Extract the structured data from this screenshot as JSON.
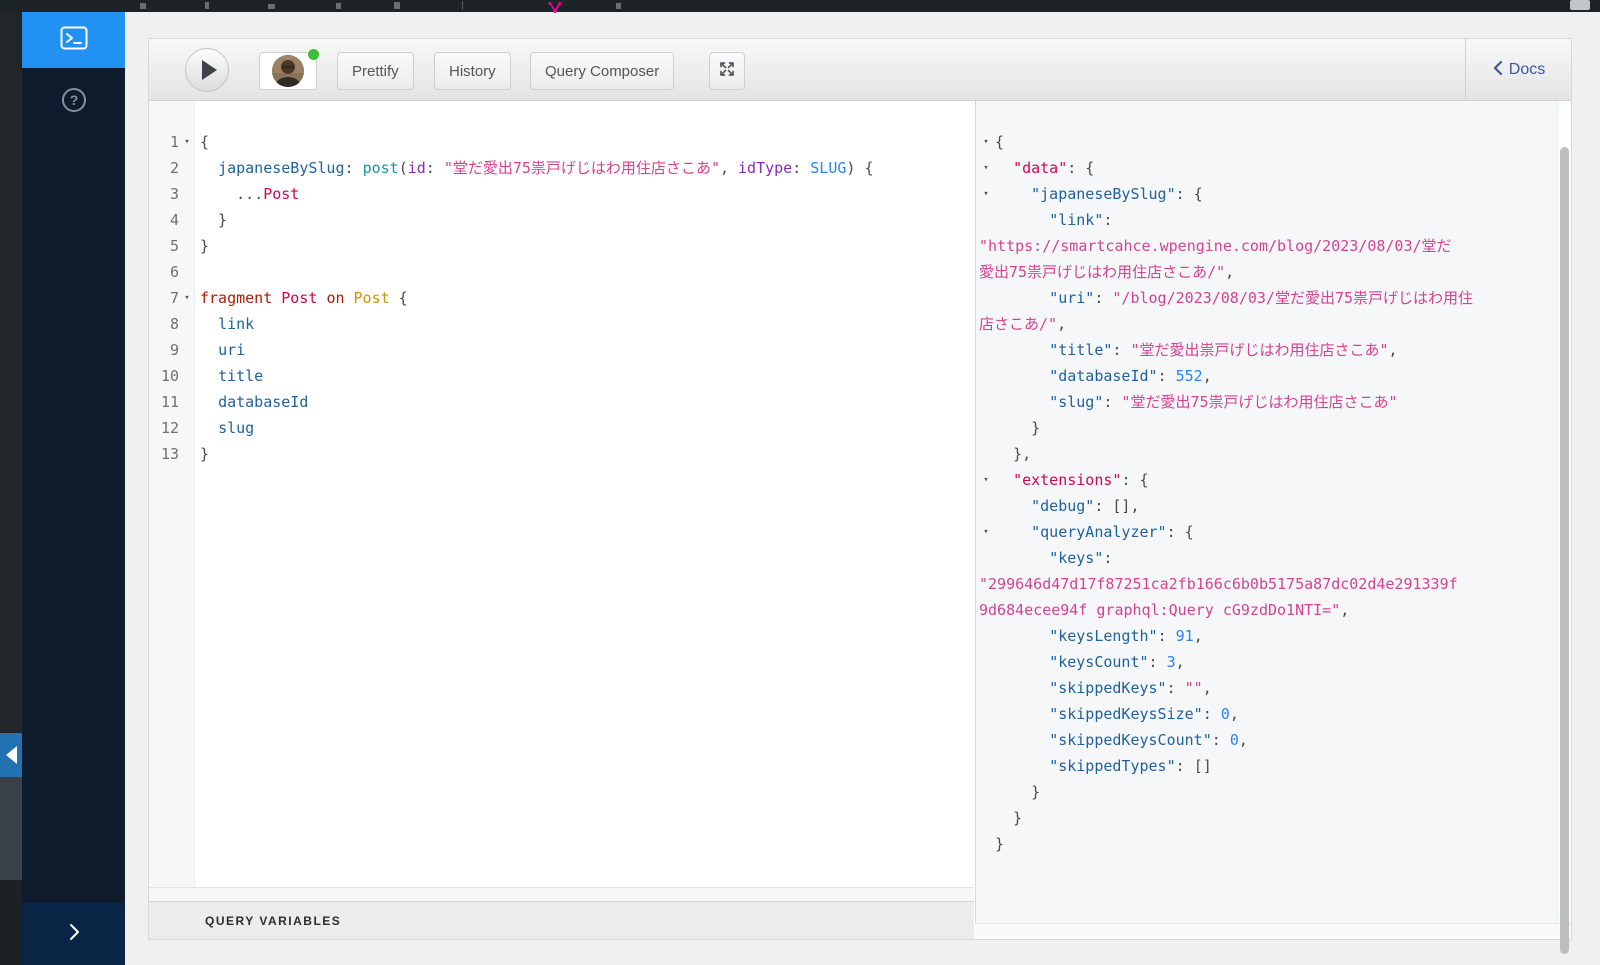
{
  "colors": {
    "admin_bar_bg": "#1d2327",
    "sidebar_bg": "#0d1b2c",
    "sidebar_active": "#2191f3",
    "graphql_magenta": "#e10098",
    "status_green": "#3cc13b",
    "docs_blue": "#3b5998",
    "tok_property": "#1F61A0",
    "tok_alias_field": "#1C92A9",
    "tok_argument": "#8B2BB9",
    "tok_string": "#D64292",
    "tok_number": "#2882F9",
    "tok_keyword": "#B11A04",
    "tok_def": "#D2054E",
    "tok_type": "#CA9800",
    "tok_punct": "#4a4a4a"
  },
  "admin_bar": {
    "graphql_logo_icon": "graphql-logo-icon",
    "user_icon": "admin-bar-user-icon"
  },
  "sidebar": {
    "items": [
      {
        "label": "",
        "icon": "terminal-icon",
        "active": true
      },
      {
        "label": "",
        "icon": "question-icon",
        "active": false
      }
    ],
    "collapse_icon": "chevron-right-icon"
  },
  "toolbar": {
    "play_icon": "play-icon",
    "avatar_icon": "user-avatar",
    "prettify_label": "Prettify",
    "history_label": "History",
    "query_composer_label": "Query Composer",
    "expand_icon": "fullscreen-icon",
    "docs_chevron_icon": "chevron-left-icon",
    "docs_label": "Docs"
  },
  "variables_panel": {
    "title": "QUERY VARIABLES"
  },
  "editor": {
    "lines": [
      {
        "n": 1,
        "fold": true,
        "t": [
          [
            "{",
            "pun"
          ]
        ]
      },
      {
        "n": 2,
        "t": [
          [
            "  "
          ],
          [
            "japaneseBySlug",
            "prop"
          ],
          [
            ":",
            "pun"
          ],
          [
            " "
          ],
          [
            "post",
            "qual"
          ],
          [
            "(",
            "pun"
          ],
          [
            "id",
            "attr"
          ],
          [
            ":",
            "pun"
          ],
          [
            " "
          ],
          [
            "\"堂だ愛出75祟戸げじはわ用住店さこあ\"",
            "str"
          ],
          [
            ",",
            "pun"
          ],
          [
            " "
          ],
          [
            "idType",
            "attr"
          ],
          [
            ":",
            "pun"
          ],
          [
            " "
          ],
          [
            "SLUG",
            "num"
          ],
          [
            ") {",
            "pun"
          ]
        ]
      },
      {
        "n": 3,
        "t": [
          [
            "    "
          ],
          [
            "...",
            "pun"
          ],
          [
            "Post",
            "def"
          ]
        ]
      },
      {
        "n": 4,
        "t": [
          [
            "  }",
            "pun"
          ]
        ]
      },
      {
        "n": 5,
        "t": [
          [
            "}",
            "pun"
          ]
        ]
      },
      {
        "n": 6,
        "t": [
          [
            ""
          ]
        ]
      },
      {
        "n": 7,
        "fold": true,
        "t": [
          [
            "fragment",
            "kw"
          ],
          [
            " "
          ],
          [
            "Post",
            "def"
          ],
          [
            " "
          ],
          [
            "on",
            "kw"
          ],
          [
            " "
          ],
          [
            "Post",
            "atom"
          ],
          [
            " {",
            "pun"
          ]
        ]
      },
      {
        "n": 8,
        "t": [
          [
            "  "
          ],
          [
            "link",
            "prop"
          ]
        ]
      },
      {
        "n": 9,
        "t": [
          [
            "  "
          ],
          [
            "uri",
            "prop"
          ]
        ]
      },
      {
        "n": 10,
        "t": [
          [
            "  "
          ],
          [
            "title",
            "prop"
          ]
        ]
      },
      {
        "n": 11,
        "t": [
          [
            "  "
          ],
          [
            "databaseId",
            "prop"
          ]
        ]
      },
      {
        "n": 12,
        "t": [
          [
            "  "
          ],
          [
            "slug",
            "prop"
          ]
        ]
      },
      {
        "n": 13,
        "t": [
          [
            "}",
            "pun"
          ]
        ]
      }
    ]
  },
  "response": {
    "lines": [
      {
        "fold": true,
        "t": [
          [
            "{",
            "pun"
          ]
        ]
      },
      {
        "fold": true,
        "t": [
          [
            "  "
          ],
          [
            "\"data\"",
            "def"
          ],
          [
            ": {",
            "pun"
          ]
        ]
      },
      {
        "fold": true,
        "t": [
          [
            "    "
          ],
          [
            "\"japaneseBySlug\"",
            "prop"
          ],
          [
            ": {",
            "pun"
          ]
        ]
      },
      {
        "t": [
          [
            "      "
          ],
          [
            "\"link\"",
            "prop"
          ],
          [
            ":",
            "pun"
          ]
        ]
      },
      {
        "wrap": true,
        "t": [
          [
            "\"https://smartcahce.wpengine.com/blog/2023/08/03/堂だ",
            "str"
          ]
        ]
      },
      {
        "wrap": true,
        "t": [
          [
            "愛出75祟戸げじはわ用住店さこあ/\"",
            "str"
          ],
          [
            ",",
            "pun"
          ]
        ]
      },
      {
        "t": [
          [
            "      "
          ],
          [
            "\"uri\"",
            "prop"
          ],
          [
            ": ",
            "pun"
          ],
          [
            "\"/blog/2023/08/03/堂だ愛出75祟戸げじはわ用住",
            "str"
          ]
        ]
      },
      {
        "wrap": true,
        "t": [
          [
            "店さこあ/\"",
            "str"
          ],
          [
            ",",
            "pun"
          ]
        ]
      },
      {
        "t": [
          [
            "      "
          ],
          [
            "\"title\"",
            "prop"
          ],
          [
            ": ",
            "pun"
          ],
          [
            "\"堂だ愛出祟戸げじはわ用住店さこあ\"",
            "str"
          ],
          [
            ",",
            "pun"
          ]
        ]
      },
      {
        "t": [
          [
            "      "
          ],
          [
            "\"databaseId\"",
            "prop"
          ],
          [
            ": ",
            "pun"
          ],
          [
            "552",
            "num"
          ],
          [
            ",",
            "pun"
          ]
        ]
      },
      {
        "t": [
          [
            "      "
          ],
          [
            "\"slug\"",
            "prop"
          ],
          [
            ": ",
            "pun"
          ],
          [
            "\"堂だ愛出75祟戸げじはわ用住店さこあ\"",
            "str"
          ]
        ]
      },
      {
        "t": [
          [
            "    }",
            "pun"
          ]
        ]
      },
      {
        "t": [
          [
            "  },",
            "pun"
          ]
        ]
      },
      {
        "fold": true,
        "t": [
          [
            "  "
          ],
          [
            "\"extensions\"",
            "def"
          ],
          [
            ": {",
            "pun"
          ]
        ]
      },
      {
        "t": [
          [
            "    "
          ],
          [
            "\"debug\"",
            "prop"
          ],
          [
            ": ",
            "pun"
          ],
          [
            "[],",
            "pun"
          ]
        ]
      },
      {
        "fold": true,
        "t": [
          [
            "    "
          ],
          [
            "\"queryAnalyzer\"",
            "prop"
          ],
          [
            ": {",
            "pun"
          ]
        ]
      },
      {
        "t": [
          [
            "      "
          ],
          [
            "\"keys\"",
            "prop"
          ],
          [
            ":",
            "pun"
          ]
        ]
      },
      {
        "wrap": true,
        "t": [
          [
            "\"299646d47d17f87251ca2fb166c6b0b5175a87dc02d4e291339f",
            "str"
          ]
        ]
      },
      {
        "wrap": true,
        "t": [
          [
            "9d684ecee94f graphql:Query cG9zdDo1NTI=\"",
            "str"
          ],
          [
            ",",
            "pun"
          ]
        ]
      },
      {
        "t": [
          [
            "      "
          ],
          [
            "\"keysLength\"",
            "prop"
          ],
          [
            ": ",
            "pun"
          ],
          [
            "91",
            "num"
          ],
          [
            ",",
            "pun"
          ]
        ]
      },
      {
        "t": [
          [
            "      "
          ],
          [
            "\"keysCount\"",
            "prop"
          ],
          [
            ": ",
            "pun"
          ],
          [
            "3",
            "num"
          ],
          [
            ",",
            "pun"
          ]
        ]
      },
      {
        "t": [
          [
            "      "
          ],
          [
            "\"skippedKeys\"",
            "prop"
          ],
          [
            ": ",
            "pun"
          ],
          [
            "\"\"",
            "str"
          ],
          [
            ",",
            "pun"
          ]
        ]
      },
      {
        "t": [
          [
            "      "
          ],
          [
            "\"skippedKeysSize\"",
            "prop"
          ],
          [
            ": ",
            "pun"
          ],
          [
            "0",
            "num"
          ],
          [
            ",",
            "pun"
          ]
        ]
      },
      {
        "t": [
          [
            "      "
          ],
          [
            "\"skippedKeysCount\"",
            "prop"
          ],
          [
            ": ",
            "pun"
          ],
          [
            "0",
            "num"
          ],
          [
            ",",
            "pun"
          ]
        ]
      },
      {
        "t": [
          [
            "      "
          ],
          [
            "\"skippedTypes\"",
            "prop"
          ],
          [
            ": ",
            "pun"
          ],
          [
            "[]",
            "pun"
          ]
        ]
      },
      {
        "t": [
          [
            "    }",
            "pun"
          ]
        ]
      },
      {
        "t": [
          [
            "  }",
            "pun"
          ]
        ]
      },
      {
        "t": [
          [
            "}",
            "pun"
          ]
        ]
      }
    ]
  }
}
